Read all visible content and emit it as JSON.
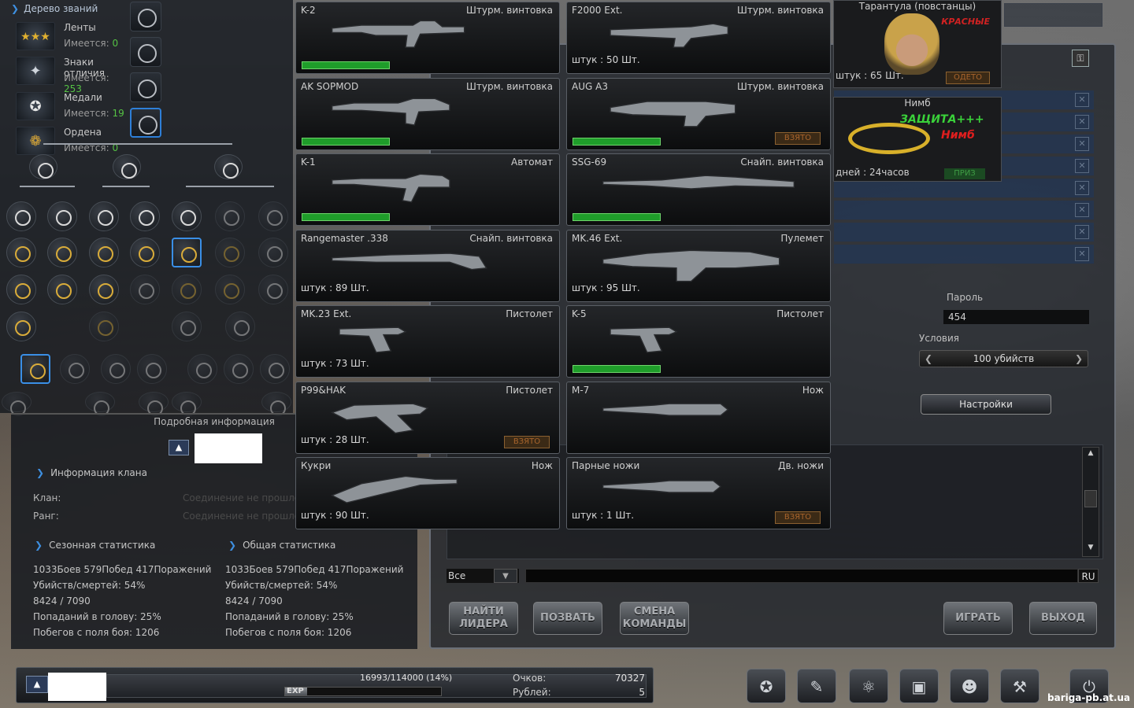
{
  "rank_tree": {
    "title": "Дерево званий",
    "awards": [
      {
        "name": "Ленты",
        "count_label": "Имеется:",
        "count": "0",
        "icon": "ribbons-icon"
      },
      {
        "name": "Знаки отличия",
        "count_label": "Имеется:",
        "count": "253",
        "icon": "badge-icon"
      },
      {
        "name": "Медали",
        "count_label": "Имеется:",
        "count": "19",
        "icon": "medal-icon"
      },
      {
        "name": "Ордена",
        "count_label": "Имеется:",
        "count": "0",
        "icon": "order-icon"
      }
    ]
  },
  "detail": {
    "header": "Подробная информация",
    "clan_info_title": "Информация клана",
    "clan_label": "Клан:",
    "clan_value": "Соединение не прошло",
    "rank_label": "Ранг:",
    "rank_value": "Соединение не прошло",
    "season": {
      "title": "Сезонная статистика",
      "lines": [
        "1033Боев 579Побед 417Поражений",
        "Убийств/смертей: 54%",
        "8424 / 7090",
        "Попаданий в голову: 25%",
        "Побегов с поля боя: 1206"
      ]
    },
    "total": {
      "title": "Общая статистика",
      "lines": [
        "1033Боев 579Побед 417Поражений",
        "Убийств/смертей: 54%",
        "8424 / 7090",
        "Попаданий в голову: 25%",
        "Побегов с поля боя: 1206"
      ]
    }
  },
  "weapons": [
    {
      "name": "K-2",
      "type": "Штурм. винтовка",
      "qty": "",
      "bar": true,
      "taken": ""
    },
    {
      "name": "F2000 Ext.",
      "type": "Штурм. винтовка",
      "qty": "штук : 50 Шт.",
      "bar": false,
      "taken": ""
    },
    {
      "name": "AK SOPMOD",
      "type": "Штурм. винтовка",
      "qty": "",
      "bar": true,
      "taken": ""
    },
    {
      "name": "AUG A3",
      "type": "Штурм. винтовка",
      "qty": "",
      "bar": true,
      "taken": "ВЗЯТО"
    },
    {
      "name": "K-1",
      "type": "Автомат",
      "qty": "",
      "bar": true,
      "taken": ""
    },
    {
      "name": "SSG-69",
      "type": "Снайп. винтовка",
      "qty": "",
      "bar": true,
      "taken": ""
    },
    {
      "name": "Rangemaster .338",
      "type": "Снайп. винтовка",
      "qty": "штук : 89 Шт.",
      "bar": false,
      "taken": ""
    },
    {
      "name": "MK.46 Ext.",
      "type": "Пулемет",
      "qty": "штук : 95 Шт.",
      "bar": false,
      "taken": ""
    },
    {
      "name": "MK.23 Ext.",
      "type": "Пистолет",
      "qty": "штук : 73 Шт.",
      "bar": false,
      "taken": ""
    },
    {
      "name": "K-5",
      "type": "Пистолет",
      "qty": "",
      "bar": true,
      "taken": ""
    },
    {
      "name": "P99&HAK",
      "type": "Пистолет",
      "qty": "штук : 28 Шт.",
      "bar": false,
      "taken": "ВЗЯТО"
    },
    {
      "name": "M-7",
      "type": "Нож",
      "qty": "",
      "bar": false,
      "taken": ""
    },
    {
      "name": "Кукри",
      "type": "Нож",
      "qty": "штук : 90 Шт.",
      "bar": false,
      "taken": ""
    },
    {
      "name": "Парные ножи",
      "type": "Дв. ножи",
      "qty": "штук : 1 Шт.",
      "bar": false,
      "taken": "ВЗЯТО"
    }
  ],
  "character": {
    "title": "Тарантула (повстанцы)",
    "team": "КРАСНЫЕ",
    "qty": "штук : 65 Шт.",
    "status": "ОДЕТО"
  },
  "nimb": {
    "title": "Нимб",
    "line1": "ЗАЩИТА+++",
    "line2": "Нимб",
    "days": "дней : 24часов",
    "badge": "ПРИЗ"
  },
  "room": {
    "password_label": "Пароль",
    "password_value": "454",
    "conditions_label": "Условия",
    "conditions_value": "100 убийств",
    "settings_button": "Настройки",
    "chat_filter": "Все",
    "chat_lang": "RU",
    "buttons": {
      "find_leader": "НАЙТИ ЛИДЕРА",
      "invite": "ПОЗВАТЬ",
      "change_team": "СМЕНА КОМАНДЫ",
      "play": "ИГРАТЬ",
      "exit": "ВЫХОД"
    }
  },
  "bottom_bar": {
    "xp_text": "16993/114000 (14%)",
    "xp_label": "EXP",
    "xp_fraction": 0.14,
    "points_label": "Очков:",
    "points_value": "70327",
    "rubles_label": "Рублей:",
    "rubles_value": "5"
  },
  "watermark": "bariga-pb.at.ua"
}
